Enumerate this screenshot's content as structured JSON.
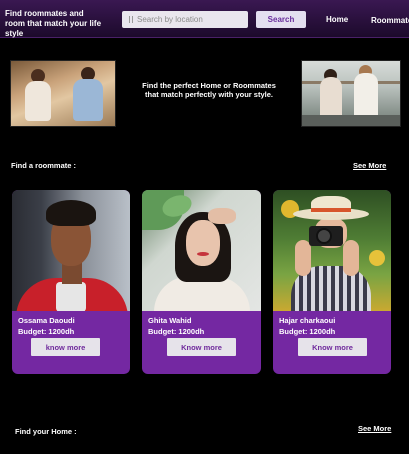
{
  "header": {
    "brand": "Find roommates and room that match your life style",
    "search_placeholder": "Search by location",
    "search_button": "Search",
    "nav": [
      "Home",
      "Roommates"
    ]
  },
  "hero": {
    "tagline": "Find the perfect Home or Roommates that match perfectly with your style."
  },
  "roommates_section": {
    "title": "Find a roommate :",
    "see_more": "See More",
    "cards": [
      {
        "name": "Ossama Daoudi",
        "budget": "Budget: 1200dh",
        "button": "know more"
      },
      {
        "name": "Ghita Wahid",
        "budget": "Budget: 1200dh",
        "button": "Know more"
      },
      {
        "name": "Hajar charkaoui",
        "budget": "Budget: 1200dh",
        "button": "Know more"
      }
    ]
  },
  "home_section": {
    "title": "Find your Home :",
    "see_more": "See More"
  },
  "colors": {
    "accent": "#7428a2",
    "header_bg": "#2a1140",
    "button_bg": "#e6e3ea"
  }
}
